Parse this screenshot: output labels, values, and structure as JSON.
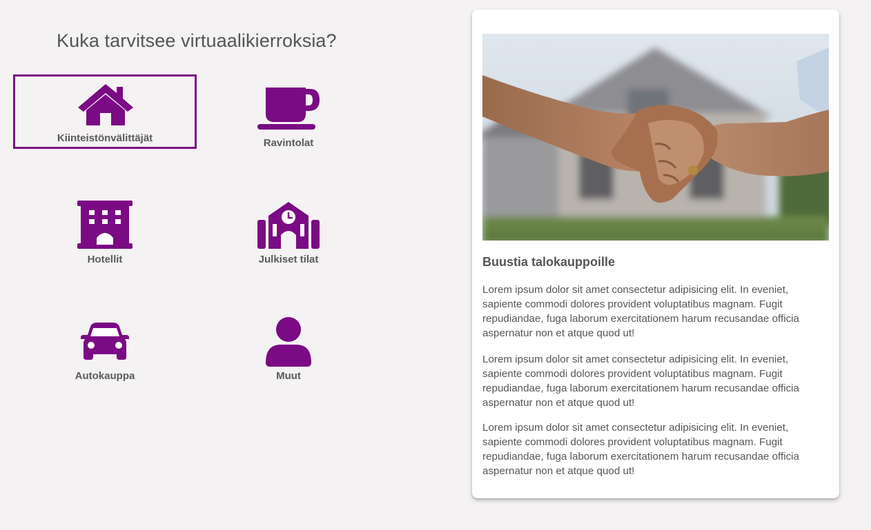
{
  "section": {
    "heading": "Kuka tarvitsee virtuaalikierroksia?"
  },
  "categories": [
    {
      "label": "Kiinteistönvälittäjät",
      "icon": "house-icon",
      "active": true
    },
    {
      "label": "Ravintolat",
      "icon": "coffee-cup-icon",
      "active": false
    },
    {
      "label": "Hotellit",
      "icon": "hotel-icon",
      "active": false
    },
    {
      "label": "Julkiset tilat",
      "icon": "school-building-icon",
      "active": false
    },
    {
      "label": "Autokauppa",
      "icon": "car-icon",
      "active": false
    },
    {
      "label": "Muut",
      "icon": "person-icon",
      "active": false
    }
  ],
  "card": {
    "image_icon": "handshake-house-photo",
    "title": "Buustia talokauppoille",
    "paragraphs": [
      "Lorem ipsum dolor sit amet consectetur adipisicing elit. In eveniet, sapiente commodi dolores provident voluptatibus magnam. Fugit repudiandae, fuga laborum exercitationem harum recusandae officia aspernatur non et atque quod ut!",
      "Lorem ipsum dolor sit amet consectetur adipisicing elit. In eveniet, sapiente commodi dolores provident voluptatibus magnam. Fugit repudiandae, fuga laborum exercitationem harum recusandae officia aspernatur non et atque quod ut!",
      "Lorem ipsum dolor sit amet consectetur adipisicing elit. In eveniet, sapiente commodi dolores provident voluptatibus magnam. Fugit repudiandae, fuga laborum exercitationem harum recusandae officia aspernatur non et atque quod ut!"
    ]
  },
  "colors": {
    "accent": "#7b0a85",
    "background": "#f4f2f2",
    "text": "#555555"
  }
}
